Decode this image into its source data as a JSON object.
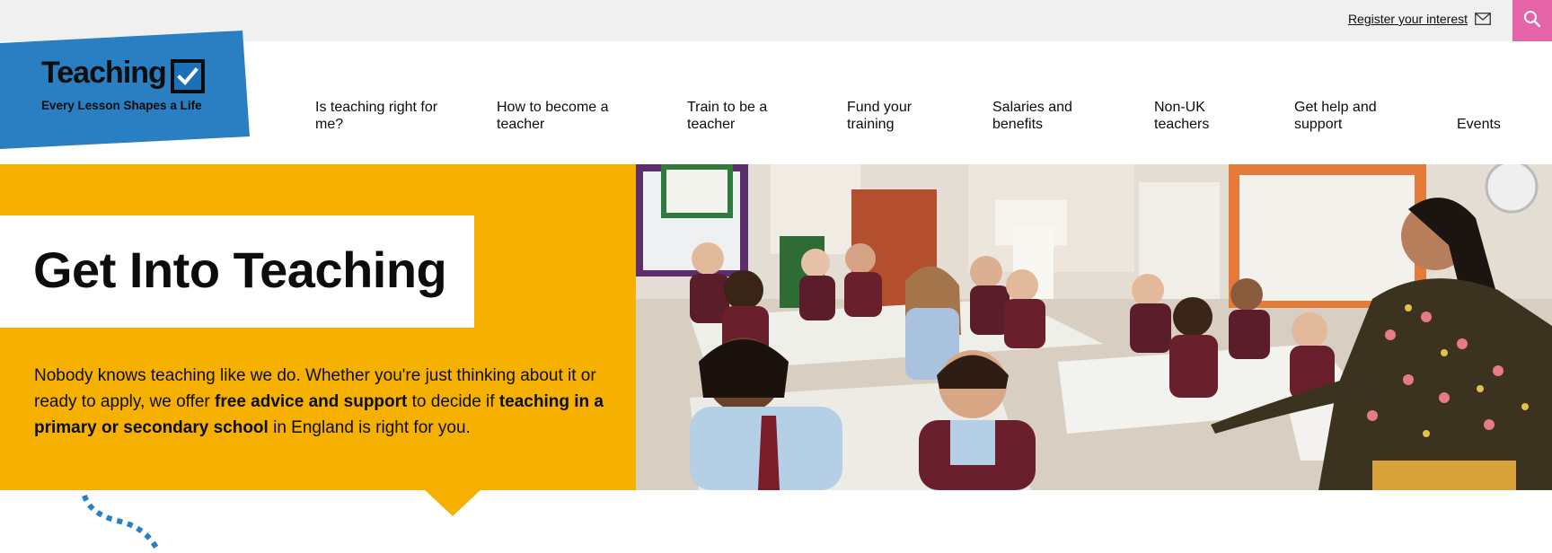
{
  "topbar": {
    "register_label": "Register your interest",
    "mail_icon": "mail-icon",
    "search_icon": "search-icon",
    "search_bg": "#e563a7"
  },
  "logo": {
    "title": "Teaching",
    "tagline": "Every Lesson Shapes a Life",
    "bg": "#2a7fc2"
  },
  "nav": {
    "items": [
      {
        "label": "Is teaching right for me?"
      },
      {
        "label": "How to become a teacher"
      },
      {
        "label": "Train to be a teacher"
      },
      {
        "label": "Fund your training"
      },
      {
        "label": "Salaries and benefits"
      },
      {
        "label": "Non-UK teachers"
      },
      {
        "label": "Get help and support"
      },
      {
        "label": "Events"
      }
    ]
  },
  "hero": {
    "title": "Get Into Teaching",
    "text_1": "Nobody knows teaching like we do. Whether you're just thinking about it or ready to apply, we offer ",
    "bold_1": "free advice and support",
    "text_2": " to decide if ",
    "bold_2": "teaching in a primary or secondary school",
    "text_3": " in England is right for you.",
    "accent": "#f6b100"
  }
}
